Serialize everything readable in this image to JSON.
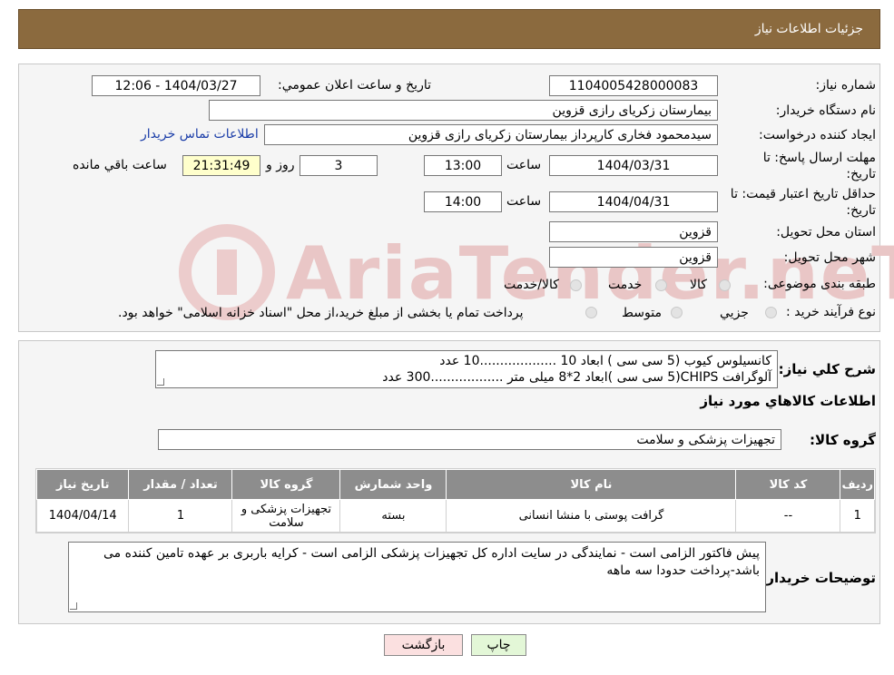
{
  "header": {
    "title": "جزئیات اطلاعات نیاز"
  },
  "watermark": "AriaTender.neT",
  "form": {
    "need_number_label": "شماره نیاز:",
    "need_number": "1104005428000083",
    "announce_label": "تاریخ و ساعت اعلان عمومي:",
    "announce_value": "1404/03/27 - 12:06",
    "buyer_org_label": "نام دستگاه خریدار:",
    "buyer_org": "بیمارستان زکریای رازی قزوین",
    "creator_label": "ایجاد کننده درخواست:",
    "creator": "سیدمحمود فخاری کارپرداز بیمارستان زکریای رازی قزوین",
    "contact_link": "اطلاعات تماس خریدار",
    "deadline_label_1": "مهلت ارسال پاسخ: تا",
    "deadline_label_2": "تاریخ:",
    "deadline_date": "1404/03/31",
    "time_label": "ساعت",
    "deadline_time": "13:00",
    "days_value": "3",
    "days_label": "روز و",
    "remaining_time": "21:31:49",
    "remaining_label": "ساعت باقي مانده",
    "validity_label_1": "حداقل تاریخ اعتبار قیمت: تا",
    "validity_label_2": "تاریخ:",
    "validity_date": "1404/04/31",
    "validity_time": "14:00",
    "province_label": "استان محل تحویل:",
    "province": "قزوین",
    "city_label": "شهر محل تحویل:",
    "city": "قزوین",
    "category_label": "طبقه بندی موضوعی:",
    "category_options": [
      "کالا",
      "خدمت",
      "کالا/خدمت"
    ],
    "process_label": "نوع فرآیند خرید :",
    "process_options": [
      "جزیي",
      "متوسط"
    ],
    "process_note": "پرداخت تمام یا بخشی از مبلغ خرید،از محل \"اسناد خزانه اسلامی\" خواهد بود."
  },
  "summary": {
    "label": "شرح کلي نیاز:",
    "line1": "کانسیلوس کیوب (5 سی سی ) ابعاد 10   ...................10 عدد",
    "line2": "آلوگرافت CHIPS(5 سی سی )ابعاد 2*8    میلی متر   ..................300 عدد"
  },
  "goods": {
    "section_title": "اطلاعات کالاهاي مورد نیاز",
    "group_label": "گروه کالا:",
    "group_value": "تجهیزات پزشکی و سلامت",
    "columns": [
      "ردیف",
      "کد کالا",
      "نام کالا",
      "واحد شمارش",
      "گروه کالا",
      "تعداد / مقدار",
      "تاریخ نیاز"
    ],
    "rows": [
      [
        "1",
        "--",
        "گرافت پوستی با منشا انسانی",
        "بسته",
        "تجهیزات پزشکی و سلامت",
        "1",
        "1404/04/14"
      ]
    ]
  },
  "notes": {
    "label": "توضیحات خریدار:",
    "text": "پیش فاکتور الزامی است - نمایندگی در سایت اداره کل تجهیزات پزشکی الزامی است - کرایه باربری بر عهده تامین کننده می باشد-پرداخت حدودا سه ماهه"
  },
  "buttons": {
    "print": "چاپ",
    "back": "بازگشت"
  },
  "colors": {
    "header_bg": "#8b6a3e",
    "back_bg": "#fbe0e0",
    "print_bg": "#e3f7d7",
    "link": "#1a3da8"
  }
}
